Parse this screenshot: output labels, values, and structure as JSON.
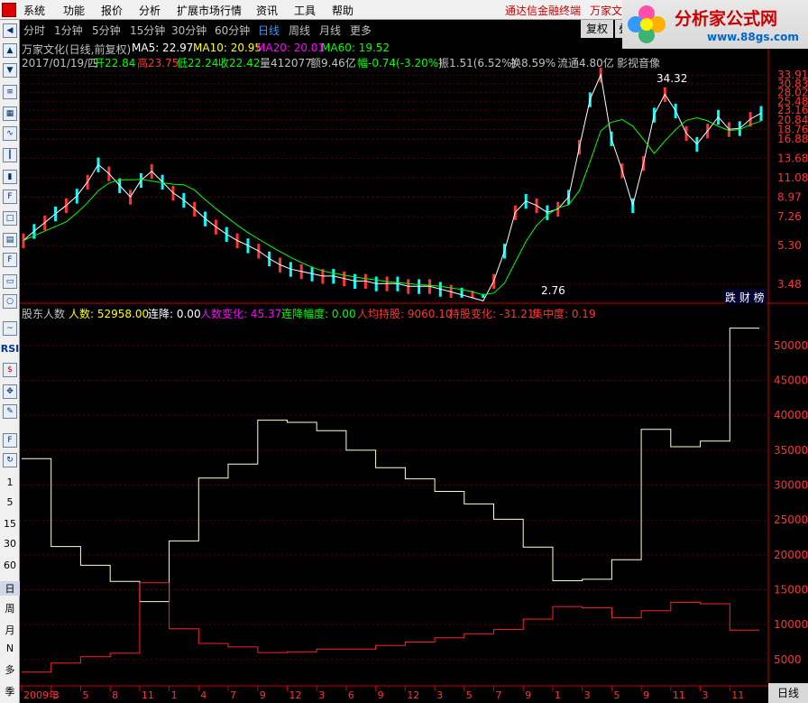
{
  "menubar": {
    "items": [
      "系统",
      "功能",
      "报价",
      "分析",
      "扩展市场行情",
      "资讯",
      "工具",
      "帮助"
    ],
    "right_a": "通达信金融终端",
    "right_b": "万家文"
  },
  "brand": {
    "title": "分析家公式网",
    "url": "www.88gs.com"
  },
  "periods": [
    "分时",
    "1分钟",
    "5分钟",
    "15分钟",
    "30分钟",
    "60分钟",
    "日线",
    "周线",
    "月线",
    "更多"
  ],
  "active_period": "日线",
  "fuquan": "复权",
  "fuquan2": "叠",
  "header1": {
    "name": "万家文化(日线,前复权)",
    "ma5": "MA5: 22.97",
    "ma10": "MA10: 20.95",
    "ma20": "MA20: 20.01",
    "ma60": "MA60: 19.52"
  },
  "header2": {
    "date": "2017/01/19/四",
    "open": "开22.84",
    "high": "高23.75",
    "low": "低22.24",
    "close": "收22.42",
    "vol": "量412077",
    "amt": "额9.46亿",
    "chg": "幅-0.74(-3.20%)",
    "amp": "振1.51(6.52%)",
    "turn": "换8.59%",
    "float": "流通4.80亿",
    "yy": "影视音像"
  },
  "indicator": {
    "name": "股东人数",
    "rs": "人数: 52958.00",
    "lj": "连降: 0.00",
    "rsbh": "人数变化: 45.37",
    "ljfd": "连降幅度: 0.00",
    "rjcg": "人均持股: 9060.10",
    "cgbh": "持股变化: -31.21",
    "jzd": "集中度: 0.19"
  },
  "jc_label": "跌 财 榜",
  "bottom_right": "日线",
  "left_toolbar_text": [
    "RSI",
    "1",
    "5",
    "15",
    "30",
    "60",
    "日",
    "周",
    "月",
    "N",
    "多",
    "季"
  ],
  "colors": {
    "up": "#ff3333",
    "down": "#00ffff",
    "ma5": "#ffffff",
    "ma10": "#ffff00",
    "ma20": "#ff00ff",
    "ma60": "#00ff00",
    "axis": "#cc0000"
  },
  "chart_data": [
    {
      "type": "line",
      "title": "",
      "ylabel": "",
      "y_ticks": [
        33.91,
        30.83,
        28.02,
        25.48,
        23.16,
        20.84,
        18.76,
        16.88,
        13.68,
        11.08,
        8.97,
        7.26,
        5.3,
        3.48
      ],
      "annotations": [
        {
          "label": "34.32"
        },
        {
          "label": "2.76"
        }
      ],
      "series": [
        {
          "name": "MA5",
          "values": [
            5.6,
            6.2,
            6.8,
            7.5,
            8.2,
            9.1,
            10.6,
            12.8,
            11.6,
            10.2,
            9.0,
            10.8,
            11.9,
            10.6,
            9.4,
            8.7,
            7.9,
            7.1,
            6.5,
            6.0,
            5.6,
            5.3,
            5.0,
            4.6,
            4.3,
            4.1,
            4.0,
            3.9,
            3.8,
            3.8,
            3.7,
            3.6,
            3.6,
            3.5,
            3.5,
            3.5,
            3.4,
            3.4,
            3.4,
            3.3,
            3.2,
            3.1,
            3.0,
            2.9,
            3.6,
            5.0,
            7.6,
            8.6,
            8.2,
            7.6,
            7.9,
            9.0,
            15.5,
            26.0,
            34.0,
            17.0,
            12.0,
            8.2,
            13.0,
            22.0,
            27.5,
            23.0,
            18.0,
            16.0,
            18.5,
            21.5,
            18.8,
            19.0,
            21.0,
            22.4
          ]
        }
      ]
    },
    {
      "type": "line",
      "title": "",
      "ylabel": "",
      "y_ticks": [
        50000,
        45000,
        40000,
        35000,
        30000,
        25000,
        20000,
        15000,
        10000,
        5000
      ],
      "x_ticks": [
        "2009年",
        "3",
        "5",
        "8",
        "11",
        "1",
        "4",
        "7",
        "9",
        "12",
        "3",
        "6",
        "9",
        "12",
        "3",
        "5",
        "7",
        "9",
        "1",
        "3",
        "5",
        "9",
        "11",
        "3",
        "11"
      ],
      "series": [
        {
          "name": "人数",
          "values": [
            33800,
            21200,
            18500,
            16200,
            13300,
            22000,
            31000,
            33000,
            39300,
            39000,
            37800,
            35000,
            32500,
            30900,
            29100,
            27300,
            25100,
            21100,
            16300,
            16500,
            19300,
            38000,
            35500,
            36300,
            52500
          ]
        },
        {
          "name": "人均持股",
          "values": [
            3200,
            4500,
            5400,
            5900,
            16000,
            9400,
            7300,
            6800,
            6000,
            6100,
            6500,
            6500,
            7000,
            7500,
            8100,
            8700,
            9300,
            10800,
            12600,
            12400,
            11000,
            12000,
            13200,
            13000,
            9200
          ]
        }
      ]
    }
  ]
}
